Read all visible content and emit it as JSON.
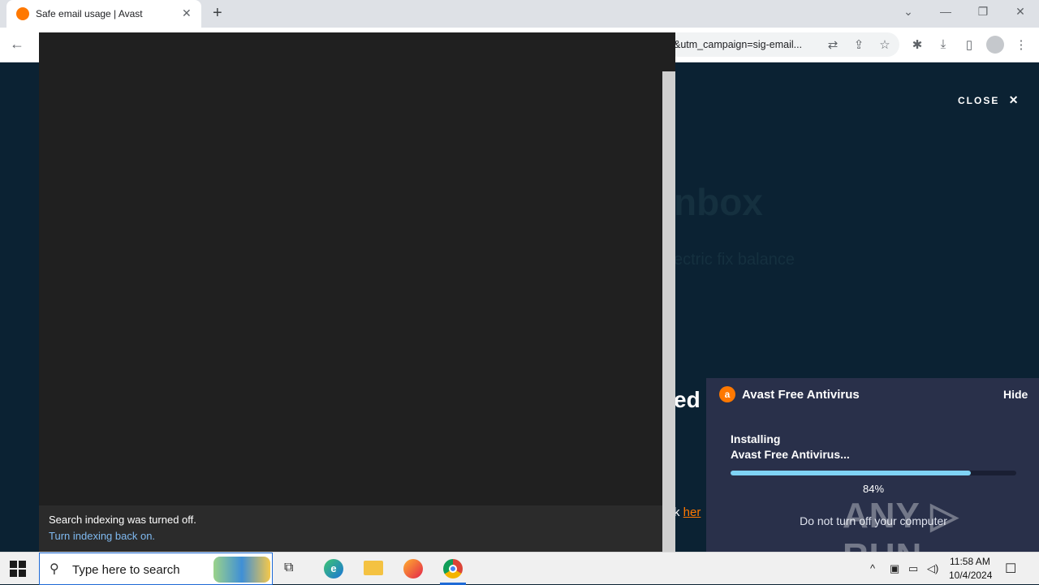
{
  "browser": {
    "tab_title": "Safe email usage | Avast",
    "new_tab": "+",
    "tab_close": "✕",
    "url": "&utm_campaign=sig-email...",
    "window_controls": {
      "dropdown": "⌄",
      "minimize": "—",
      "restore": "❐",
      "close": "✕"
    }
  },
  "page": {
    "close_label": "CLOSE",
    "close_icon": "✕",
    "ghost_title": "nbox",
    "ghost_sub": "ectric fix balance",
    "partial_heading": "ed",
    "partial_text": "k ",
    "partial_link": "her"
  },
  "search_overlay": {
    "notice_title": "Search indexing was turned off.",
    "notice_link": "Turn indexing back on."
  },
  "avast_popup": {
    "title": "Avast Free Antivirus",
    "logo_letter": "a",
    "hide_label": "Hide",
    "status_line1": "Installing",
    "status_line2": "Avast Free Antivirus...",
    "progress": 0.84,
    "percent_text": "84%",
    "warning": "Do not turn off your computer",
    "accent_color": "#ff7800"
  },
  "watermark": "ANY ▷ RUN",
  "taskbar": {
    "search_placeholder": "Type here to search",
    "search_icon": "⚲",
    "clock_time": "11:58 AM",
    "clock_date": "10/4/2024",
    "apps": [
      "task-view-icon",
      "edge-icon",
      "file-explorer-icon",
      "firefox-icon",
      "chrome-icon"
    ]
  }
}
